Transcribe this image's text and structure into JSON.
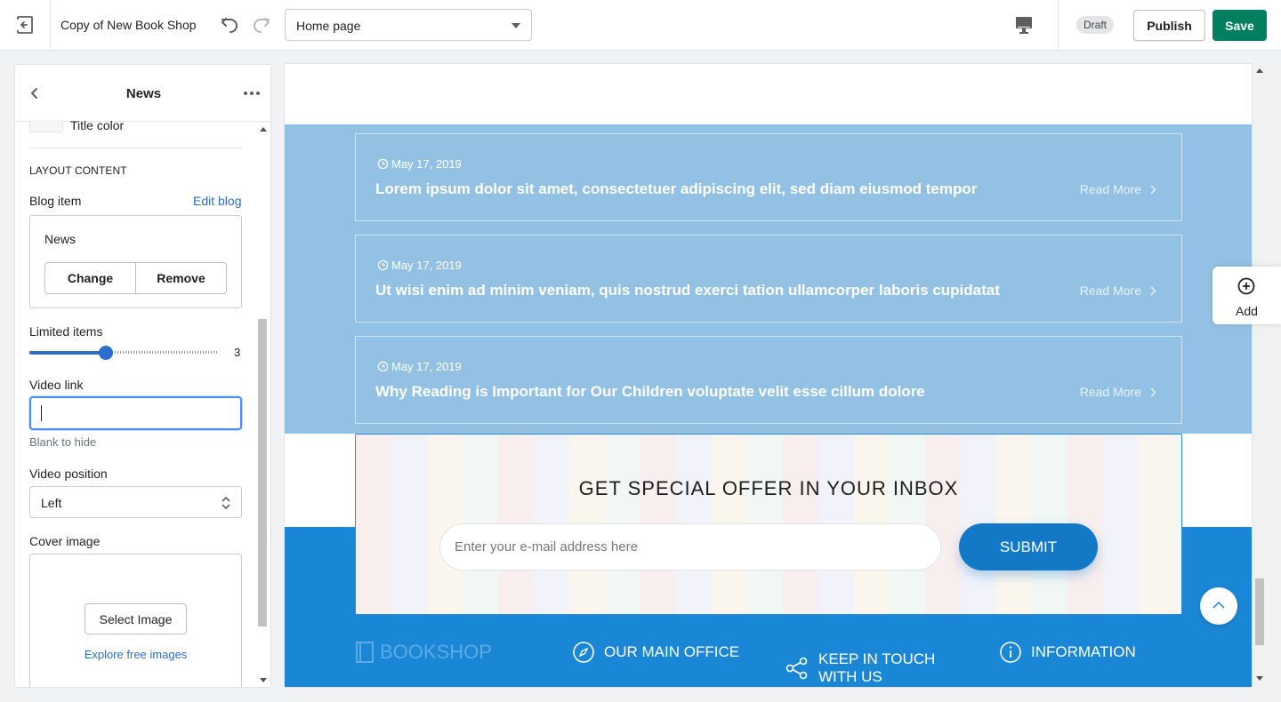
{
  "topbar": {
    "store_name": "Copy of New Book Shop",
    "page_select": "Home page",
    "status_badge": "Draft",
    "publish_label": "Publish",
    "save_label": "Save"
  },
  "panel": {
    "title": "News",
    "title_color_label": "Title color",
    "section_heading": "LAYOUT CONTENT",
    "blog_item_label": "Blog item",
    "edit_blog_link": "Edit blog",
    "selected_blog": "News",
    "change_label": "Change",
    "remove_label": "Remove",
    "limited_items_label": "Limited items",
    "limited_items_value": "3",
    "video_link_label": "Video link",
    "video_link_value": "",
    "video_link_help": "Blank to hide",
    "video_position_label": "Video position",
    "video_position_value": "Left",
    "cover_image_label": "Cover image",
    "select_image_label": "Select Image",
    "explore_images_link": "Explore free images"
  },
  "preview": {
    "news": [
      {
        "date": "May 17, 2019",
        "title": "Lorem ipsum dolor sit amet, consectetuer adipiscing elit, sed diam eiusmod tempor",
        "read_more": "Read More"
      },
      {
        "date": "May 17, 2019",
        "title": "Ut wisi enim ad minim veniam, quis nostrud exerci tation ullamcorper laboris cupidatat",
        "read_more": "Read More"
      },
      {
        "date": "May 17, 2019",
        "title": "Why Reading is Important for Our Children voluptate velit esse cillum dolore",
        "read_more": "Read More"
      }
    ],
    "offer_title": "GET SPECIAL OFFER IN YOUR INBOX",
    "email_placeholder": "Enter your e-mail address here",
    "submit_label": "SUBMIT",
    "add_label": "Add",
    "footer": {
      "brand": "BOOKSHOP",
      "office": "OUR MAIN OFFICE",
      "keep_in_touch_line1": "KEEP IN TOUCH",
      "keep_in_touch_line2": "WITH US",
      "information": "INFORMATION"
    }
  },
  "colors": {
    "save_green": "#008060",
    "accent_blue": "#2c6ecb",
    "news_bg": "#93c1e3",
    "footer_blue": "#1a87d6",
    "submit_blue": "#1378c5"
  }
}
